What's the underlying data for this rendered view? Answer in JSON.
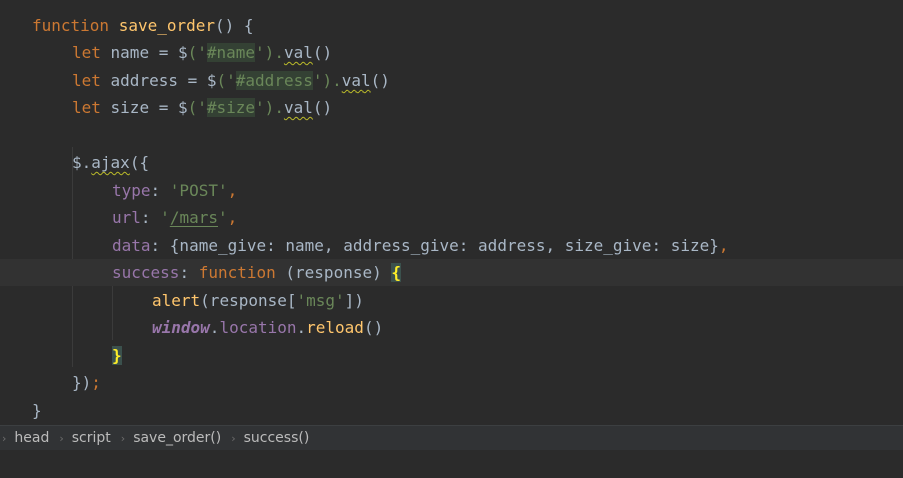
{
  "editor": {
    "lines": {
      "l1": {
        "kw": "function",
        "name": "save_order",
        "rest": "() {"
      },
      "l2": {
        "kw": "let",
        "var": " name = ",
        "jq": "$",
        "p1": "('",
        "sel": "#name",
        "p2": "').",
        "method": "val",
        "end": "()"
      },
      "l3": {
        "kw": "let",
        "var": " address = ",
        "jq": "$",
        "p1": "('",
        "sel": "#address",
        "p2": "').",
        "method": "val",
        "end": "()"
      },
      "l4": {
        "kw": "let",
        "var": " size = ",
        "jq": "$",
        "p1": "('",
        "sel": "#size",
        "p2": "').",
        "method": "val",
        "end": "()"
      },
      "l6": {
        "jq": "$",
        "dot": ".",
        "method": "ajax",
        "end": "({"
      },
      "l7": {
        "key": "type",
        "colon": ": ",
        "val": "'POST'",
        "comma": ","
      },
      "l8": {
        "key": "url",
        "colon": ": ",
        "q1": "'",
        "val": "/mars",
        "q2": "'",
        "comma": ","
      },
      "l9": {
        "key": "data",
        "rest": ": {name_give: name, address_give: address, size_give: size}",
        "comma": ","
      },
      "l10": {
        "key": "success",
        "colon": ": ",
        "kw": "function",
        "params": " (response) ",
        "brace": "{"
      },
      "l11": {
        "fn": "alert",
        "p1": "(response[",
        "str": "'msg'",
        "p2": "])"
      },
      "l12": {
        "glob": "window",
        "dot": ".",
        "prop": "location",
        "dot2": ".",
        "fn": "reload",
        "end": "()"
      },
      "l13": {
        "brace": "}"
      },
      "l14": {
        "text": "})",
        "semi": ";"
      },
      "l15": {
        "text": "}"
      }
    }
  },
  "breadcrumbs": {
    "items": [
      "head",
      "script",
      "save_order()",
      "success()"
    ]
  },
  "colors": {
    "background": "#2b2b2b",
    "keyword": "#cc7832",
    "function": "#ffc66d",
    "string": "#6a8759",
    "property": "#9876aa",
    "text": "#a9b7c6",
    "brace_match": "#ffef28"
  }
}
